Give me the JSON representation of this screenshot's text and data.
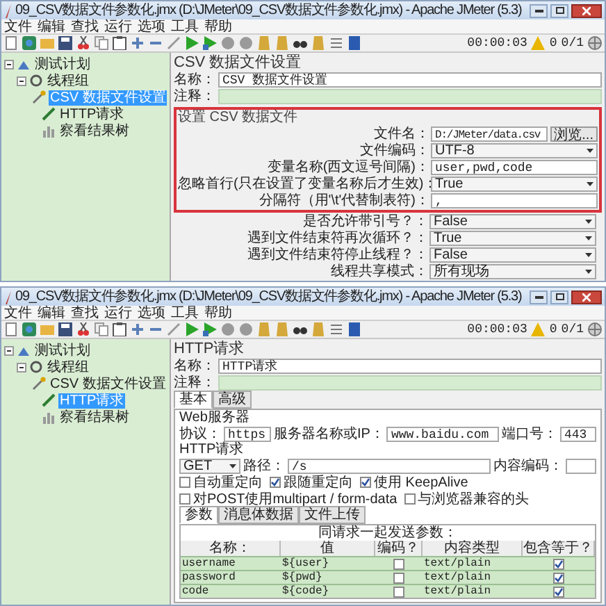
{
  "windows": [
    {
      "title": "09_CSV数据文件参数化.jmx (D:\\JMeter\\09_CSV数据文件参数化.jmx) - Apache JMeter (5.3)",
      "menu": [
        "文件",
        "编辑",
        "查找",
        "运行",
        "选项",
        "工具",
        "帮助"
      ],
      "status": {
        "timer": "00:00:03",
        "warnings": "0",
        "threads": "0/1"
      },
      "tree": [
        {
          "label": "测试计划",
          "kind": "plan",
          "selected": false,
          "expanded": true,
          "children": [
            {
              "label": "线程组",
              "kind": "threadgroup",
              "selected": false,
              "expanded": true,
              "children": [
                {
                  "label": "CSV 数据文件设置",
                  "kind": "config",
                  "selected": true
                },
                {
                  "label": "HTTP请求",
                  "kind": "sampler",
                  "selected": false
                },
                {
                  "label": "察看结果树",
                  "kind": "listener",
                  "selected": false
                }
              ]
            }
          ]
        }
      ],
      "panel": {
        "kind": "csv",
        "heading": "CSV 数据文件设置",
        "name_label": "名称：",
        "name_value": "CSV 数据文件设置",
        "comment_label": "注释：",
        "group": {
          "title": "设置 CSV 数据文件",
          "highlighted": true,
          "fields": [
            {
              "label": "文件名：",
              "value": "D:/JMeter/data.csv",
              "kind": "file",
              "button": "浏览..."
            },
            {
              "label": "文件编码：",
              "value": "UTF-8",
              "kind": "select"
            },
            {
              "label": "变量名称(西文逗号间隔)：",
              "value": "user,pwd,code",
              "kind": "text"
            },
            {
              "label": "忽略首行(只在设置了变量名称后才生效)：",
              "value": "True",
              "kind": "select"
            },
            {
              "label": "分隔符（用'\\t'代替制表符)：",
              "value": ",",
              "kind": "text"
            }
          ]
        },
        "fields": [
          {
            "label": "是否允许带引号？：",
            "value": "False",
            "kind": "select"
          },
          {
            "label": "遇到文件结束符再次循环？：",
            "value": "True",
            "kind": "select"
          },
          {
            "label": "遇到文件结束符停止线程？：",
            "value": "False",
            "kind": "select"
          },
          {
            "label": "线程共享模式：",
            "value": "所有现场",
            "kind": "select"
          }
        ]
      }
    },
    {
      "title": "09_CSV数据文件参数化.jmx (D:\\JMeter\\09_CSV数据文件参数化.jmx) - Apache JMeter (5.3)",
      "menu": [
        "文件",
        "编辑",
        "查找",
        "运行",
        "选项",
        "工具",
        "帮助"
      ],
      "status": {
        "timer": "00:00:03",
        "warnings": "0",
        "threads": "0/1"
      },
      "tree": [
        {
          "label": "测试计划",
          "kind": "plan",
          "selected": false,
          "expanded": true,
          "children": [
            {
              "label": "线程组",
              "kind": "threadgroup",
              "selected": false,
              "expanded": true,
              "children": [
                {
                  "label": "CSV 数据文件设置",
                  "kind": "config",
                  "selected": false
                },
                {
                  "label": "HTTP请求",
                  "kind": "sampler",
                  "selected": true
                },
                {
                  "label": "察看结果树",
                  "kind": "listener",
                  "selected": false
                }
              ]
            }
          ]
        }
      ],
      "panel": {
        "kind": "http",
        "heading": "HTTP请求",
        "name_label": "名称：",
        "name_value": "HTTP请求",
        "comment_label": "注释：",
        "tabs": [
          {
            "label": "基本",
            "selected": true
          },
          {
            "label": "高级",
            "selected": false
          }
        ],
        "server_title": "Web服务器",
        "protocol_label": "协议：",
        "protocol": "https",
        "server_label": "服务器名称或IP：",
        "server": "www.baidu.com",
        "port_label": "端口号：",
        "port": "443",
        "request_title": "HTTP请求",
        "method": "GET",
        "path_label": "路径：",
        "path": "/s",
        "encoding_label": "内容编码：",
        "checkboxes": [
          {
            "label": "自动重定向",
            "checked": false
          },
          {
            "label": "跟随重定向",
            "checked": true
          },
          {
            "label": "使用 KeepAlive",
            "checked": true
          },
          {
            "label": "对POST使用multipart / form-data",
            "checked": false
          },
          {
            "label": "与浏览器兼容的头",
            "checked": false
          }
        ],
        "subtabs": [
          {
            "label": "参数",
            "selected": true
          },
          {
            "label": "消息体数据",
            "selected": false
          },
          {
            "label": "文件上传",
            "selected": false
          }
        ],
        "params_title": "同请求一起发送参数：",
        "columns": [
          "名称：",
          "值",
          "编码？",
          "内容类型",
          "包含等于？"
        ],
        "rows": [
          {
            "name": "username",
            "value": "${user}",
            "encode": false,
            "content_type": "text/plain",
            "include_equals": true
          },
          {
            "name": "password",
            "value": "${pwd}",
            "encode": false,
            "content_type": "text/plain",
            "include_equals": true
          },
          {
            "name": "code",
            "value": "${code}",
            "encode": false,
            "content_type": "text/plain",
            "include_equals": true
          }
        ]
      }
    }
  ]
}
